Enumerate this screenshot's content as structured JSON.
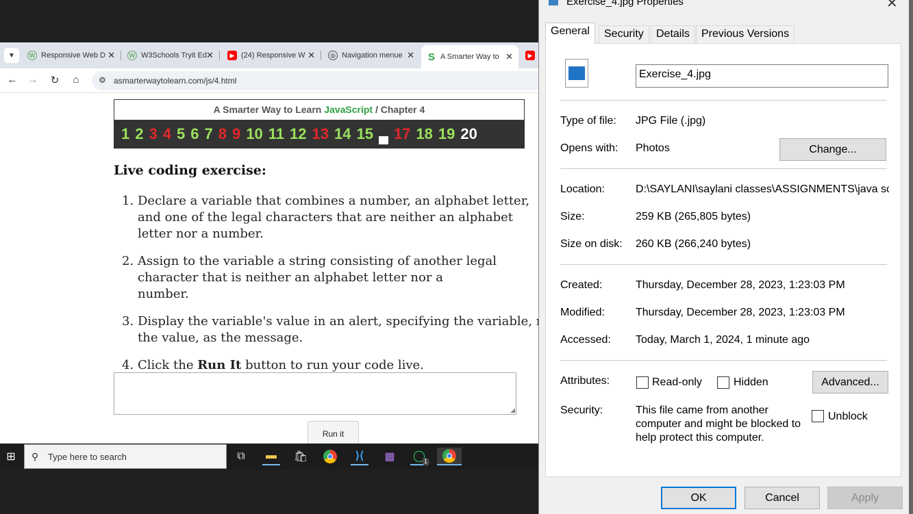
{
  "browser": {
    "tabs": [
      {
        "label": "Responsive Web D",
        "icon": "w3-globe-icon"
      },
      {
        "label": "W3Schools Tryit Ed",
        "icon": "w3-globe-icon"
      },
      {
        "label": "(24) Responsive W",
        "icon": "youtube-icon"
      },
      {
        "label": "Navigation menue",
        "icon": "globe-icon"
      },
      {
        "label": "A Smarter Way to",
        "icon": "smarterway-icon"
      }
    ],
    "url": "asmarterwaytolearn.com/js/4.html"
  },
  "page": {
    "banner_prefix": "A Smarter Way to Learn ",
    "banner_js": "JavaScript",
    "banner_chapter": " / Chapter 4",
    "numbers": [
      {
        "n": "1",
        "c": "g"
      },
      {
        "n": "2",
        "c": "g"
      },
      {
        "n": "3",
        "c": "r"
      },
      {
        "n": "4",
        "c": "r"
      },
      {
        "n": "5",
        "c": "g"
      },
      {
        "n": "6",
        "c": "g"
      },
      {
        "n": "7",
        "c": "g"
      },
      {
        "n": "8",
        "c": "r"
      },
      {
        "n": "9",
        "c": "r"
      },
      {
        "n": "10",
        "c": "g"
      },
      {
        "n": "11",
        "c": "g"
      },
      {
        "n": "12",
        "c": "g"
      },
      {
        "n": "13",
        "c": "r"
      },
      {
        "n": "14",
        "c": "g"
      },
      {
        "n": "15",
        "c": "g"
      },
      {
        "n": "17",
        "c": "r"
      },
      {
        "n": "18",
        "c": "g"
      },
      {
        "n": "19",
        "c": "g"
      },
      {
        "n": "20",
        "c": "w"
      }
    ],
    "exercise_title": "Live coding exercise:",
    "items": [
      {
        "num": "1.",
        "text": "Declare a variable that combines a number, an alphabet letter, and one of the legal characters that are neither an alphabet letter nor a number."
      },
      {
        "num": "2.",
        "text": "Assign to the variable a string consisting of another legal character that is neither an alphabet letter nor a number."
      },
      {
        "num": "3.",
        "text": "Display the variable's value in an alert, specifying the variable, not the value, as the message."
      },
      {
        "num": "4.",
        "text_before": "Click the ",
        "text_bold": "Run It",
        "text_after": " button to run your code live."
      }
    ],
    "run_button": "Run it"
  },
  "taskbar": {
    "search_placeholder": "Type here to search",
    "whatsapp_badge": "1"
  },
  "dialog": {
    "title": "Exercise_4.jpg Properties",
    "tabs": [
      "General",
      "Security",
      "Details",
      "Previous Versions"
    ],
    "filename": "Exercise_4.jpg",
    "type_label": "Type of file:",
    "type_value": "JPG File (.jpg)",
    "opens_label": "Opens with:",
    "opens_value": "Photos",
    "change_button": "Change...",
    "location_label": "Location:",
    "location_value": "D:\\SAYLANI\\saylani classes\\ASSIGNMENTS\\java sc",
    "size_label": "Size:",
    "size_value": "259 KB (265,805 bytes)",
    "size_disk_label": "Size on disk:",
    "size_disk_value": "260 KB (266,240 bytes)",
    "created_label": "Created:",
    "created_value": "Thursday, December 28, 2023, 1:23:03 PM",
    "modified_label": "Modified:",
    "modified_value": "Thursday, December 28, 2023, 1:23:03 PM",
    "accessed_label": "Accessed:",
    "accessed_value": "Today, March 1, 2024, 1 minute ago",
    "attributes_label": "Attributes:",
    "readonly_label": "Read-only",
    "hidden_label": "Hidden",
    "advanced_button": "Advanced...",
    "security_label": "Security:",
    "security_text_1": "This file came from another",
    "security_text_2": "computer and might be blocked to",
    "security_text_3": "help protect this computer.",
    "unblock_label": "Unblock",
    "ok_button": "OK",
    "cancel_button": "Cancel",
    "apply_button": "Apply"
  }
}
